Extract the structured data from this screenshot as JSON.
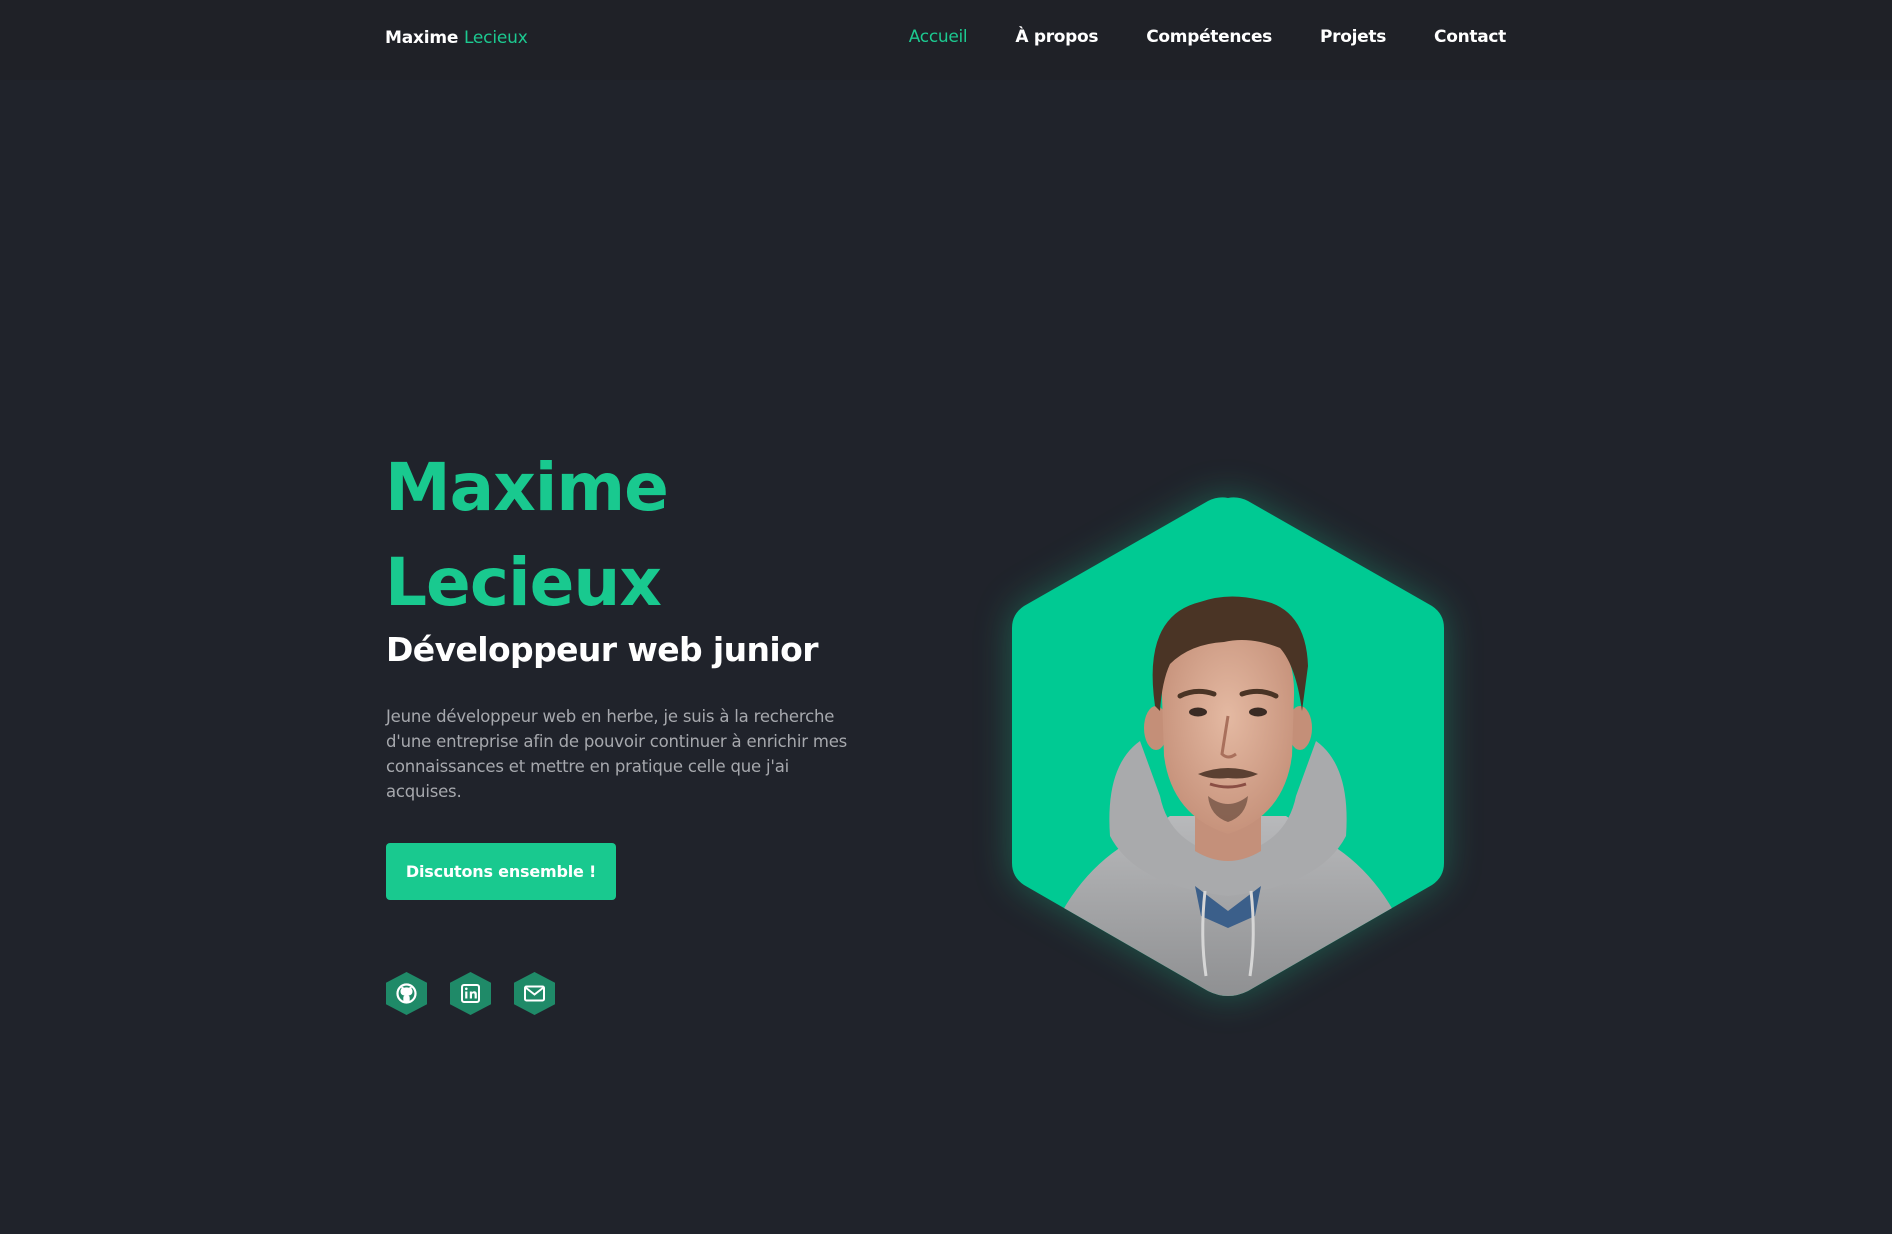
{
  "header": {
    "logo_first": "Maxime",
    "logo_last": "Lecieux",
    "nav": [
      {
        "label": "Accueil",
        "active": true
      },
      {
        "label": "À propos",
        "active": false
      },
      {
        "label": "Compétences",
        "active": false
      },
      {
        "label": "Projets",
        "active": false
      },
      {
        "label": "Contact",
        "active": false
      }
    ]
  },
  "hero": {
    "name_first": "Maxime",
    "name_last": "Lecieux",
    "role": "Développeur web junior",
    "description": "Jeune développeur web en herbe, je suis à la recherche d'une entreprise afin de pouvoir continuer à enrichir mes connaissances et mettre en pratique celle que j'ai acquises.",
    "cta_label": "Discutons ensemble !"
  },
  "socials": [
    {
      "icon": "github-icon"
    },
    {
      "icon": "linkedin-icon"
    },
    {
      "icon": "mail-icon"
    }
  ],
  "portrait": {
    "icon": "profile-photo"
  },
  "colors": {
    "background": "#20232b",
    "header": "#1f2127",
    "accent": "#19c98f",
    "social_bg": "#1f8a68",
    "text": "#ffffff",
    "muted": "#a6a8ad"
  }
}
